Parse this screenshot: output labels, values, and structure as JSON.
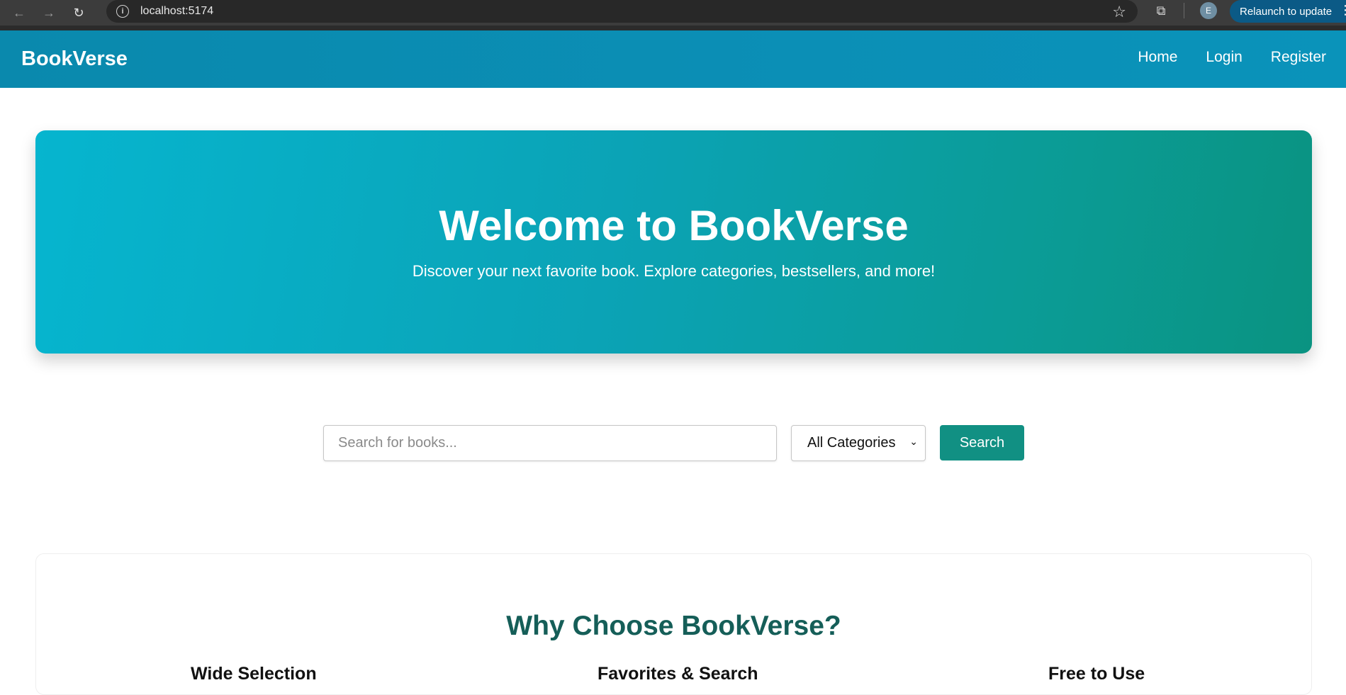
{
  "browser": {
    "back_glyph": "←",
    "forward_glyph": "→",
    "reload_glyph": "↻",
    "info_glyph": "i",
    "url": "localhost:5174",
    "star_glyph": "☆",
    "extensions_glyph": "⧉",
    "profile_initial": "E",
    "relaunch_label": "Relaunch to update",
    "menu_glyph": "⋮"
  },
  "header": {
    "brand": "BookVerse",
    "nav": {
      "home": "Home",
      "login": "Login",
      "register": "Register"
    }
  },
  "hero": {
    "title": "Welcome to BookVerse",
    "subtitle": "Discover your next favorite book. Explore categories, bestsellers, and more!"
  },
  "search": {
    "placeholder": "Search for books...",
    "category_selected": "All Categories",
    "caret_glyph": "⌄",
    "button_label": "Search"
  },
  "features": {
    "title": "Why Choose BookVerse?",
    "items": [
      {
        "heading": "Wide Selection"
      },
      {
        "heading": "Favorites & Search"
      },
      {
        "heading": "Free to Use"
      }
    ]
  },
  "colors": {
    "header_bg": "#0a8db3",
    "hero_start": "#06b5cf",
    "hero_end": "#0a9381",
    "accent": "#119083",
    "features_title": "#155e58"
  }
}
